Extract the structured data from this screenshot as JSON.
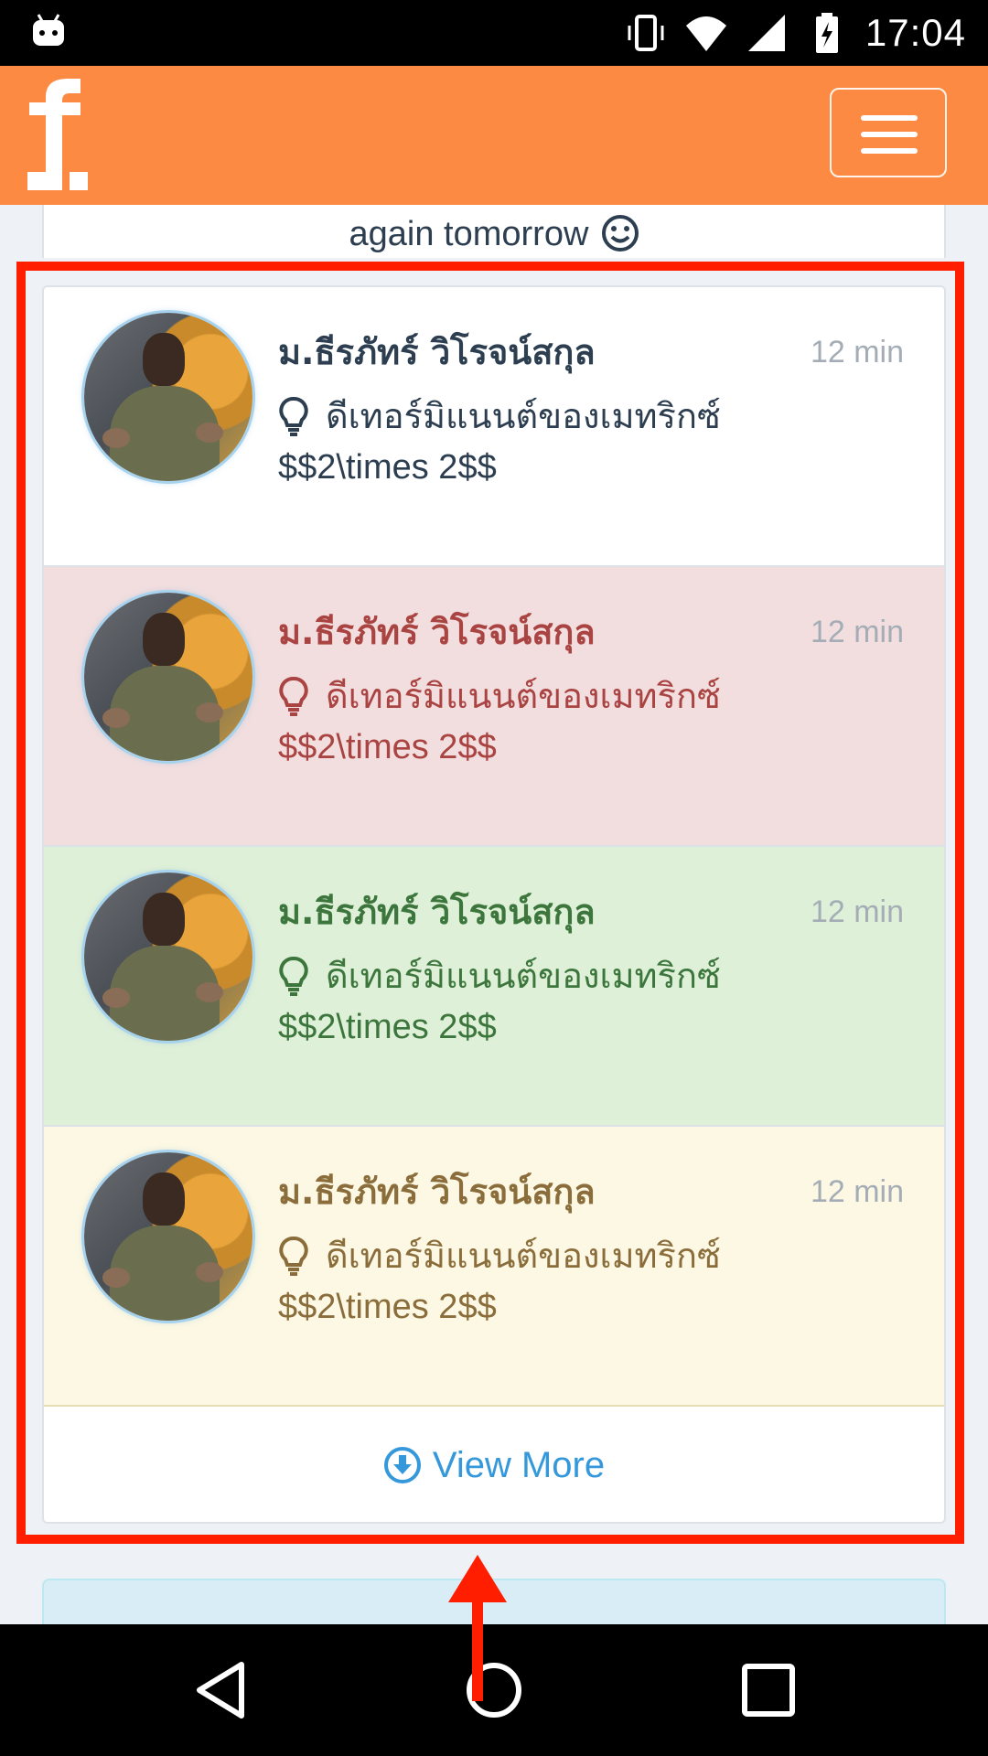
{
  "status_bar": {
    "time": "17:04",
    "icons": [
      "android-icon",
      "vibrate-icon",
      "wifi-icon",
      "signal-icon",
      "battery-charging-icon"
    ]
  },
  "header": {
    "logo_text": "f.",
    "menu_icon": "hamburger-menu-icon"
  },
  "previous_card": {
    "text": "again tomorrow",
    "emoji_icon": "smiley-icon"
  },
  "notifications": [
    {
      "style": "default",
      "name": "ม.ธีรภัทร์ วิโรจน์สกุล",
      "time": "12 min",
      "text": "ดีเทอร์มิแนนต์ของเมทริกซ์",
      "formula": "$$2\\times 2$$",
      "icon": "lightbulb-icon"
    },
    {
      "style": "danger",
      "name": "ม.ธีรภัทร์ วิโรจน์สกุล",
      "time": "12 min",
      "text": "ดีเทอร์มิแนนต์ของเมทริกซ์",
      "formula": "$$2\\times 2$$",
      "icon": "lightbulb-icon"
    },
    {
      "style": "success",
      "name": "ม.ธีรภัทร์ วิโรจน์สกุล",
      "time": "12 min",
      "text": "ดีเทอร์มิแนนต์ของเมทริกซ์",
      "formula": "$$2\\times 2$$",
      "icon": "lightbulb-icon"
    },
    {
      "style": "warning",
      "name": "ม.ธีรภัทร์ วิโรจน์สกุล",
      "time": "12 min",
      "text": "ดีเทอร์มิแนนต์ของเมทริกซ์",
      "formula": "$$2\\times 2$$",
      "icon": "lightbulb-icon"
    }
  ],
  "view_more": {
    "label": "View More",
    "icon": "download-circle-icon"
  },
  "annotation": {
    "highlight_color": "#ff1e00"
  },
  "colors": {
    "header": "#fd8a42",
    "danger_bg": "#f2dede",
    "success_bg": "#dff0d8",
    "warning_bg": "#fcf8e3",
    "link": "#3498db"
  },
  "nav_bar": {
    "buttons": [
      "back-icon",
      "home-icon",
      "recents-icon"
    ]
  }
}
